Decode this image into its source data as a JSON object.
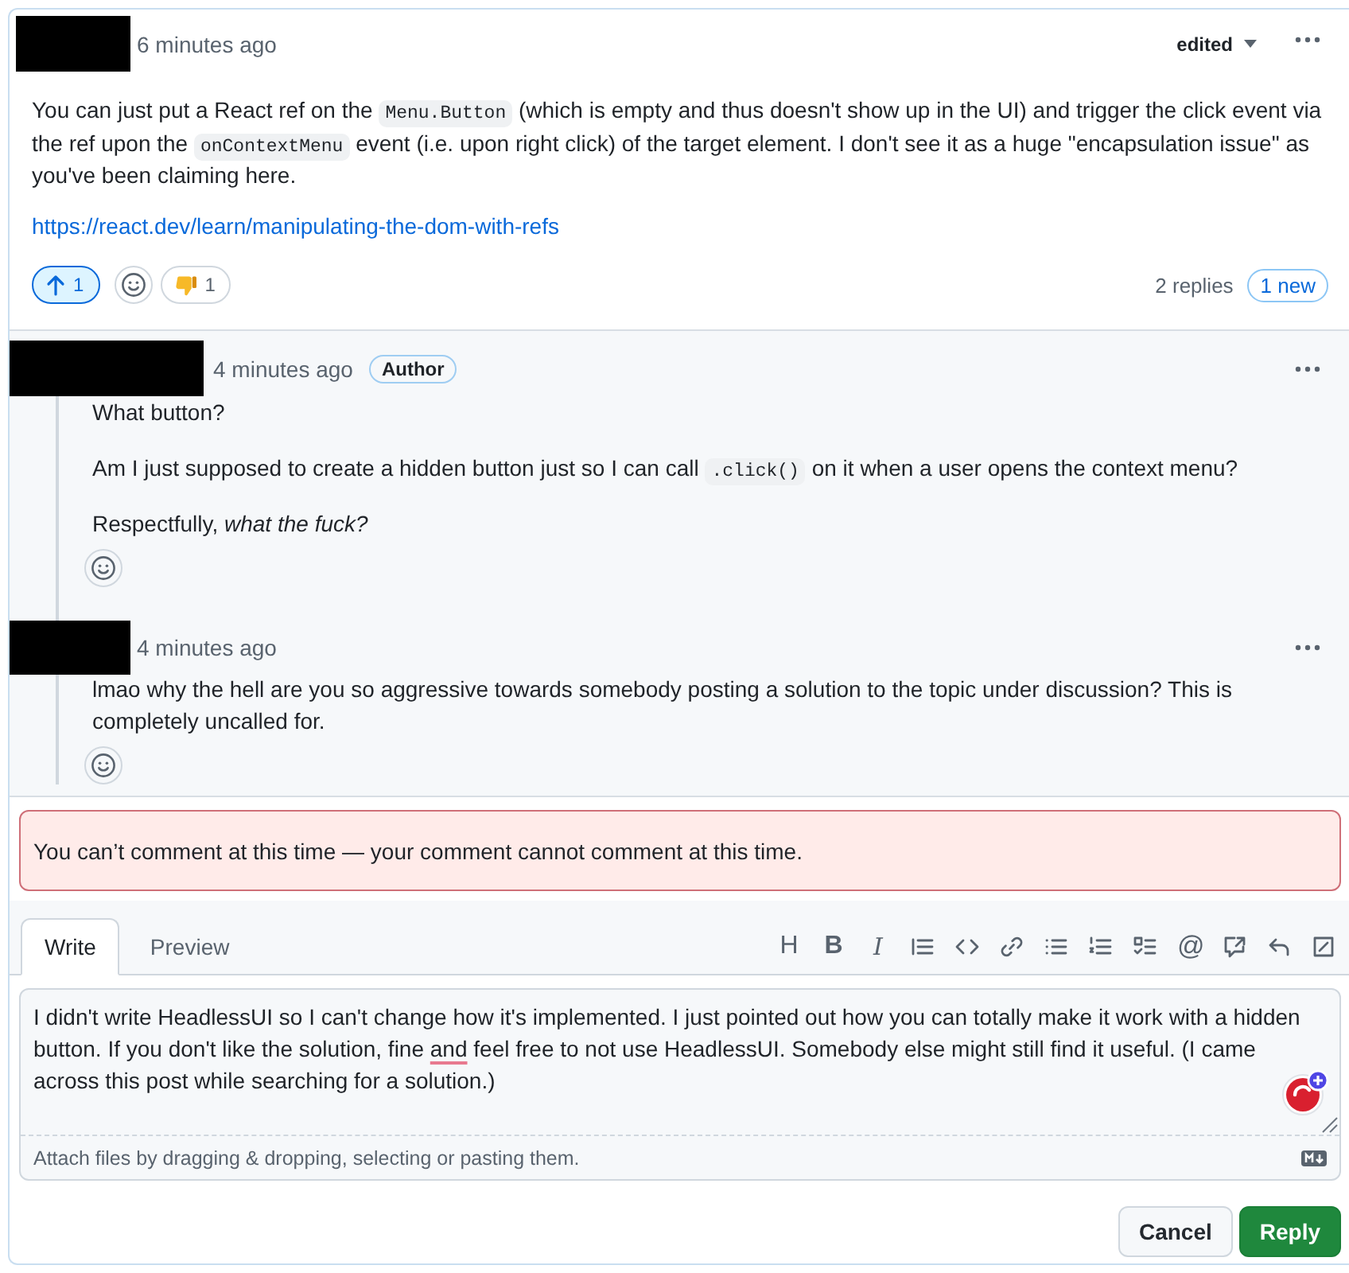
{
  "comment": {
    "time": "6 minutes ago",
    "edited_label": "edited",
    "body": [
      {
        "kind": "paragraph",
        "parts": [
          {
            "kind": "text",
            "text": "You can just put a React ref on the "
          },
          {
            "kind": "code",
            "text": "Menu.Button"
          },
          {
            "kind": "text",
            "text": " (which is empty and thus doesn't show up in the UI) and trigger the click event via the ref upon the "
          },
          {
            "kind": "code",
            "text": "onContextMenu"
          },
          {
            "kind": "text",
            "text": " event (i.e. upon right click) of the target element. I don't see it as a huge \"encapsulation issue\" as you've been claiming here."
          }
        ]
      },
      {
        "kind": "link",
        "text": "https://react.dev/learn/manipulating-the-dom-with-refs"
      }
    ],
    "reactions": [
      {
        "kind": "arrow_up",
        "count": "1",
        "selected": true
      },
      {
        "kind": "add"
      },
      {
        "kind": "thumbs_down",
        "count": "1",
        "selected": false
      }
    ],
    "replies_count": "2 replies",
    "new_badge": "1 new"
  },
  "replies": [
    {
      "time": "4 minutes ago",
      "badge": "Author",
      "body": [
        {
          "kind": "paragraph",
          "parts": [
            {
              "kind": "text",
              "text": "What button?"
            }
          ]
        },
        {
          "kind": "paragraph",
          "parts": [
            {
              "kind": "text",
              "text": "Am I just supposed to create a hidden button just so I can call "
            },
            {
              "kind": "code",
              "text": ".click()"
            },
            {
              "kind": "text",
              "text": " on it when a user opens the context menu?"
            }
          ]
        },
        {
          "kind": "paragraph",
          "parts": [
            {
              "kind": "text",
              "text": "Respectfully, *what the fuck?*"
            }
          ]
        }
      ]
    },
    {
      "time": "4 minutes ago",
      "body": [
        {
          "kind": "paragraph",
          "parts": [
            {
              "kind": "text",
              "text": "lmao why the hell are you so aggressive towards somebody posting a solution to the topic under discussion? This is completely uncalled for."
            }
          ]
        }
      ]
    }
  ],
  "notice": {
    "kind": "error",
    "text": "You can’t comment at this time — your comment cannot comment at this time."
  },
  "editor": {
    "tabs": [
      {
        "label": "Write",
        "selected": true
      },
      {
        "label": "Preview",
        "selected": false
      }
    ],
    "toolbar": [
      {
        "kind": "heading",
        "label": "H"
      },
      {
        "kind": "bold",
        "label": "B"
      },
      {
        "kind": "italic",
        "label": "I"
      },
      {
        "kind": "quote"
      },
      {
        "kind": "code"
      },
      {
        "kind": "link"
      },
      {
        "kind": "bullets"
      },
      {
        "kind": "numbers"
      },
      {
        "kind": "tasks"
      },
      {
        "kind": "mention",
        "label": "@"
      },
      {
        "kind": "reference"
      },
      {
        "kind": "undo"
      },
      {
        "kind": "slash"
      }
    ],
    "value": [
      {
        "text": "I didn't write HeadlessUI so I can't change how it's implemented. I just pointed out how you can totally make it work with a hidden button. If you don't like the solution, fine ",
        "spell_error": false
      },
      {
        "text": "and",
        "spell_error": true
      },
      {
        "text": " feel free to not use HeadlessUI. Somebody else might still find it useful. (I came across this post while searching for a solution.)",
        "spell_error": false
      }
    ],
    "footer": "Attach files by dragging & dropping, selecting or pasting them."
  },
  "actions": [
    {
      "label": "Cancel",
      "kind": "secondary"
    },
    {
      "label": "Reply",
      "kind": "primary"
    }
  ]
}
